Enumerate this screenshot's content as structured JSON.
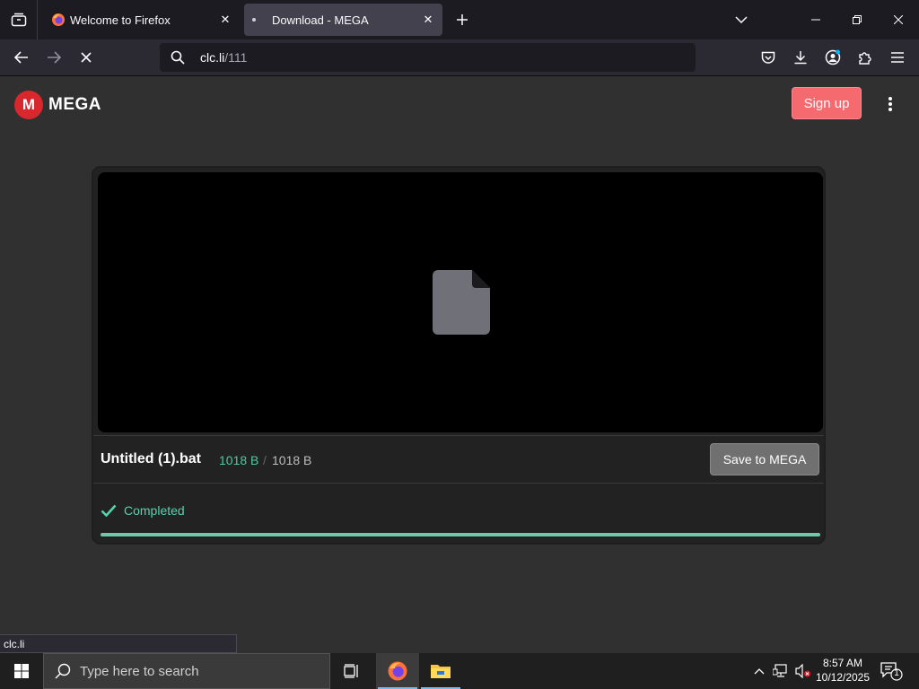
{
  "browser": {
    "tabs": [
      {
        "title": "Welcome to Firefox",
        "active": false
      },
      {
        "title": "Download - MEGA",
        "active": true
      }
    ],
    "url_host": "clc.li",
    "url_path": "/111",
    "status_tooltip": "clc.li"
  },
  "page": {
    "logo_text": "MEGA",
    "logo_letter": "M",
    "signup_label": "Sign up",
    "file": {
      "name": "Untitled (1).bat",
      "downloaded": "1018 B",
      "separator": "/",
      "total": "1018 B",
      "progress_fraction": 1.0
    },
    "save_button_label": "Save to MEGA",
    "status_text": "Completed",
    "colors": {
      "brand": "#d9272e",
      "success": "#54d3ad",
      "signup": "#f46a6e"
    }
  },
  "taskbar": {
    "search_placeholder": "Type here to search",
    "time": "8:57 AM",
    "date": "10/12/2025",
    "notification_count": "1"
  }
}
